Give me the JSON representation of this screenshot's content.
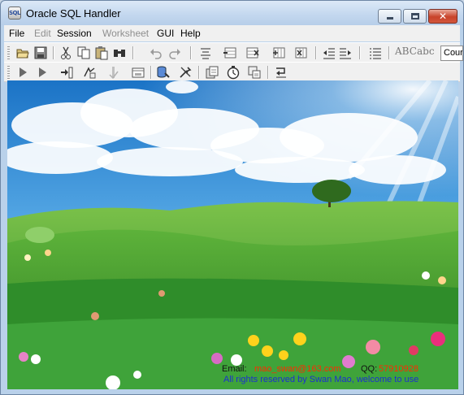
{
  "window": {
    "title": "Oracle SQL Handler",
    "app_icon_text": "SQL"
  },
  "window_controls": {
    "minimize": "minimize",
    "maximize": "maximize",
    "close": "✕"
  },
  "menu": [
    {
      "label": "File",
      "enabled": true
    },
    {
      "label": "Edit",
      "enabled": false
    },
    {
      "label": "Session",
      "enabled": true
    },
    {
      "label": "Worksheet",
      "enabled": false
    },
    {
      "label": "GUI",
      "enabled": true
    },
    {
      "label": "Help",
      "enabled": true
    }
  ],
  "toolbar1": {
    "icons": [
      "open-folder-icon",
      "save-icon",
      "cut-icon",
      "copy-icon",
      "paste-icon",
      "find-icon",
      "undo-icon",
      "redo-icon",
      "align-center-icon",
      "insert-row-icon",
      "delete-row-icon",
      "insert-column-icon",
      "delete-column-icon",
      "outdent-icon",
      "indent-icon",
      "list-icon"
    ],
    "uppercase_label": "ABC",
    "lowercase_label": "abc",
    "font_combo_value": "Courier"
  },
  "toolbar2": {
    "icons": [
      "run-icon",
      "run-step-icon",
      "execute-script-icon",
      "explain-plan-icon",
      "commit-icon",
      "rollback-icon",
      "disconnect-icon",
      "object-browser-icon",
      "tools-icon",
      "history-icon",
      "timer-icon",
      "export-icon",
      "import-icon"
    ]
  },
  "footer": {
    "email_label": "Email:",
    "email_value": "mao_swan@163.com",
    "qq_label": "QQ:",
    "qq_value": "57910928",
    "rights": "All rights reserved by Swan Mao, welcome to use"
  },
  "colors": {
    "sky_top": "#1e78c8",
    "grass": "#3c9a2e",
    "title_gradient": "#c4d8ef",
    "close_button": "#c8432b"
  }
}
